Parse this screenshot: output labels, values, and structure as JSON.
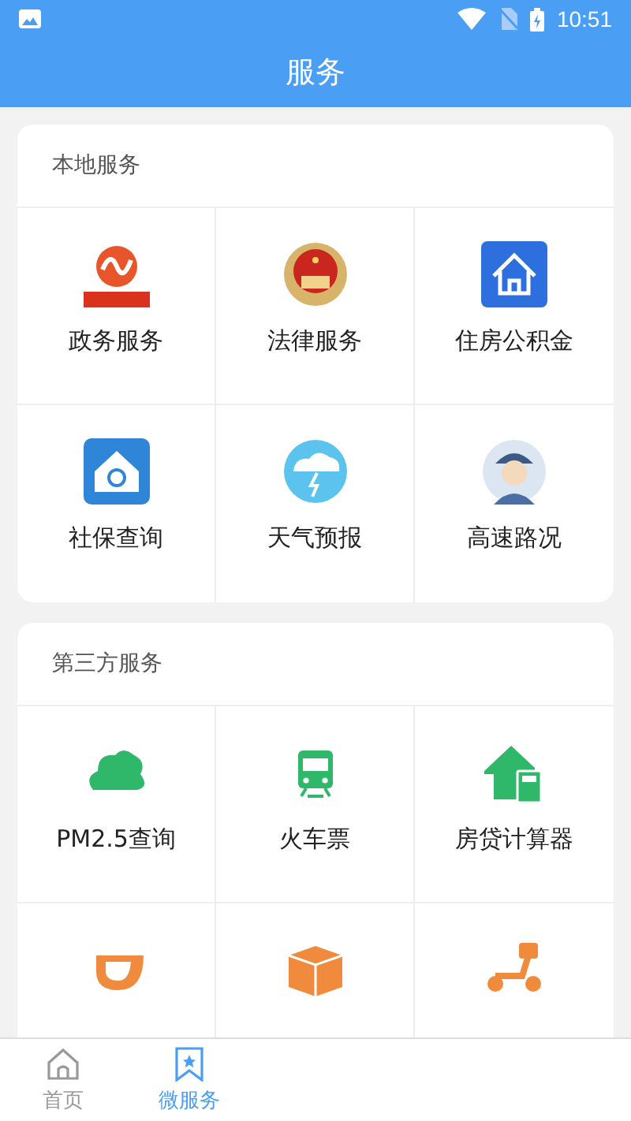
{
  "status_bar": {
    "time": "10:51"
  },
  "title": "服务",
  "sections": [
    {
      "title": "本地服务",
      "items": [
        {
          "kind": "service",
          "label": "政务服务"
        },
        {
          "kind": "service",
          "label": "法律服务"
        },
        {
          "kind": "service",
          "label": "住房公积金"
        },
        {
          "kind": "service",
          "label": "社保查询"
        },
        {
          "kind": "service",
          "label": "天气预报"
        },
        {
          "kind": "service",
          "label": "高速路况"
        }
      ]
    },
    {
      "title": "第三方服务",
      "items": [
        {
          "kind": "service",
          "label": "PM2.5查询"
        },
        {
          "kind": "service",
          "label": "火车票"
        },
        {
          "kind": "service",
          "label": "房贷计算器"
        },
        {
          "kind": "service"
        },
        {
          "kind": "service"
        },
        {
          "kind": "service"
        }
      ]
    }
  ],
  "tabs": [
    {
      "label": "首页",
      "selected": false
    },
    {
      "label": "微服务",
      "selected": true
    }
  ]
}
